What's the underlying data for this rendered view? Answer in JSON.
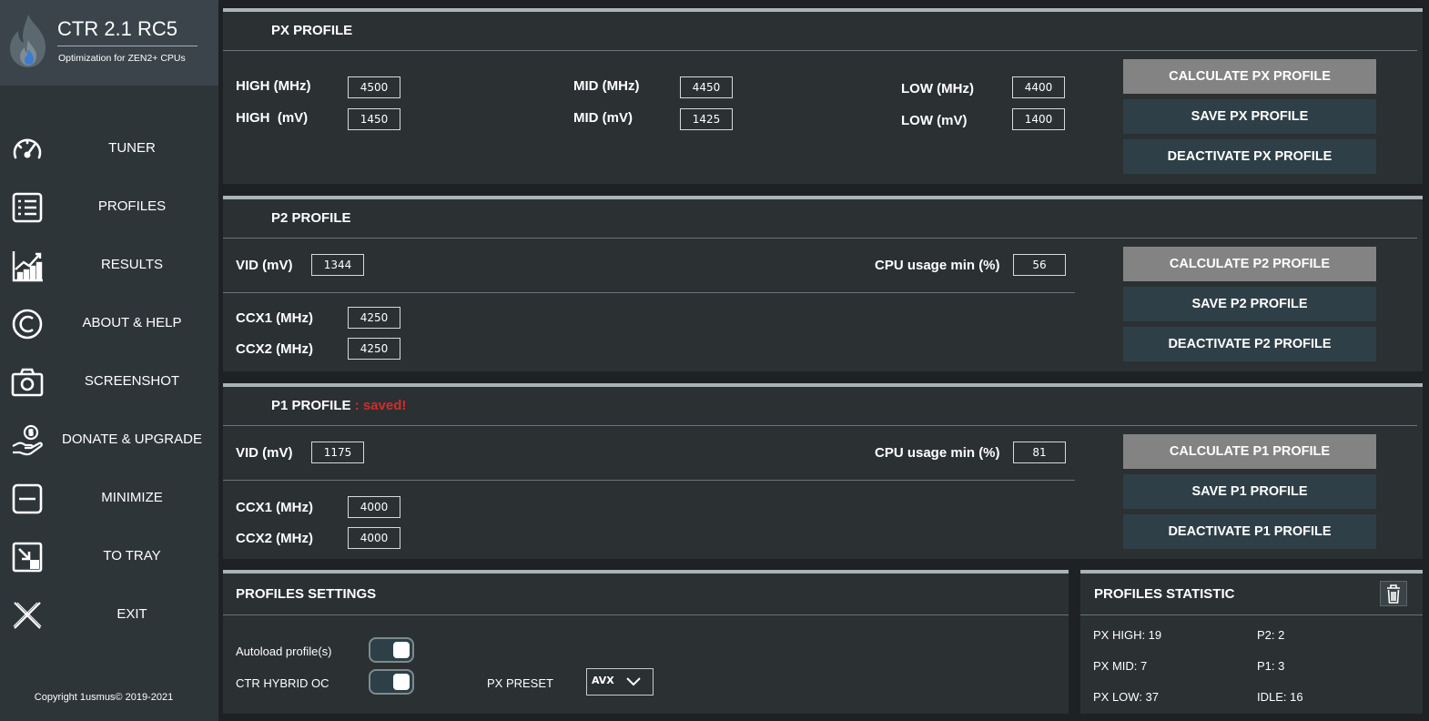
{
  "app": {
    "title": "CTR 2.1 RC5",
    "subtitle": "Optimization for ZEN2+ CPUs"
  },
  "sidebar": {
    "items": [
      {
        "label": "TUNER",
        "icon": "gauge-icon"
      },
      {
        "label": "PROFILES",
        "icon": "list-icon"
      },
      {
        "label": "RESULTS",
        "icon": "chart-icon"
      },
      {
        "label": "ABOUT & HELP",
        "icon": "copyright-icon"
      },
      {
        "label": "SCREENSHOT",
        "icon": "camera-icon"
      },
      {
        "label": "DONATE & UPGRADE",
        "icon": "donate-icon"
      },
      {
        "label": "MINIMIZE",
        "icon": "minimize-icon"
      },
      {
        "label": "TO TRAY",
        "icon": "tray-icon"
      },
      {
        "label": "EXIT",
        "icon": "close-icon"
      }
    ],
    "copyright": "Copyright 1usmus© 2019-2021"
  },
  "px": {
    "title": "PX PROFILE",
    "high_mhz_label": "HIGH (MHz)",
    "high_mhz": "4500",
    "high_mv_label": "HIGH  (mV)",
    "high_mv": "1450",
    "mid_mhz_label": "MID (MHz)",
    "mid_mhz": "4450",
    "mid_mv_label": "MID (mV)",
    "mid_mv": "1425",
    "low_mhz_label": "LOW (MHz)",
    "low_mhz": "4400",
    "low_mv_label": "LOW (mV)",
    "low_mv": "1400",
    "calc": "CALCULATE PX PROFILE",
    "save": "SAVE PX PROFILE",
    "deactivate": "DEACTIVATE PX PROFILE"
  },
  "p2": {
    "title": "P2 PROFILE",
    "vid_label": "VID (mV)",
    "vid": "1344",
    "cpu_label": "CPU usage min (%)",
    "cpu": "56",
    "ccx1_label": "CCX1 (MHz)",
    "ccx1": "4250",
    "ccx2_label": "CCX2 (MHz)",
    "ccx2": "4250",
    "calc": "CALCULATE P2 PROFILE",
    "save": "SAVE P2 PROFILE",
    "deactivate": "DEACTIVATE P2 PROFILE"
  },
  "p1": {
    "title": "P1 PROFILE",
    "status": " : saved!",
    "vid_label": "VID (mV)",
    "vid": "1175",
    "cpu_label": "CPU usage min (%)",
    "cpu": "81",
    "ccx1_label": "CCX1 (MHz)",
    "ccx1": "4000",
    "ccx2_label": "CCX2 (MHz)",
    "ccx2": "4000",
    "calc": "CALCULATE P1 PROFILE",
    "save": "SAVE P1 PROFILE",
    "deactivate": "DEACTIVATE P1 PROFILE"
  },
  "settings": {
    "title": "PROFILES SETTINGS",
    "autoload_label": "Autoload profile(s)",
    "hybrid_label": "CTR HYBRID OC",
    "preset_label": "PX PRESET",
    "preset_value": "AVX"
  },
  "stats": {
    "title": "PROFILES STATISTIC",
    "px_high": "PX HIGH: 19",
    "px_mid": "PX MID: 7",
    "px_low": "PX LOW: 37",
    "p2": "P2: 2",
    "p1": "P1: 3",
    "idle": "IDLE: 16"
  },
  "colors": {
    "accent_button": "#838383",
    "button": "#2f3f47",
    "saved": "#d42b2b",
    "panel": "#2b3033",
    "sidebar": "#2e3539"
  }
}
